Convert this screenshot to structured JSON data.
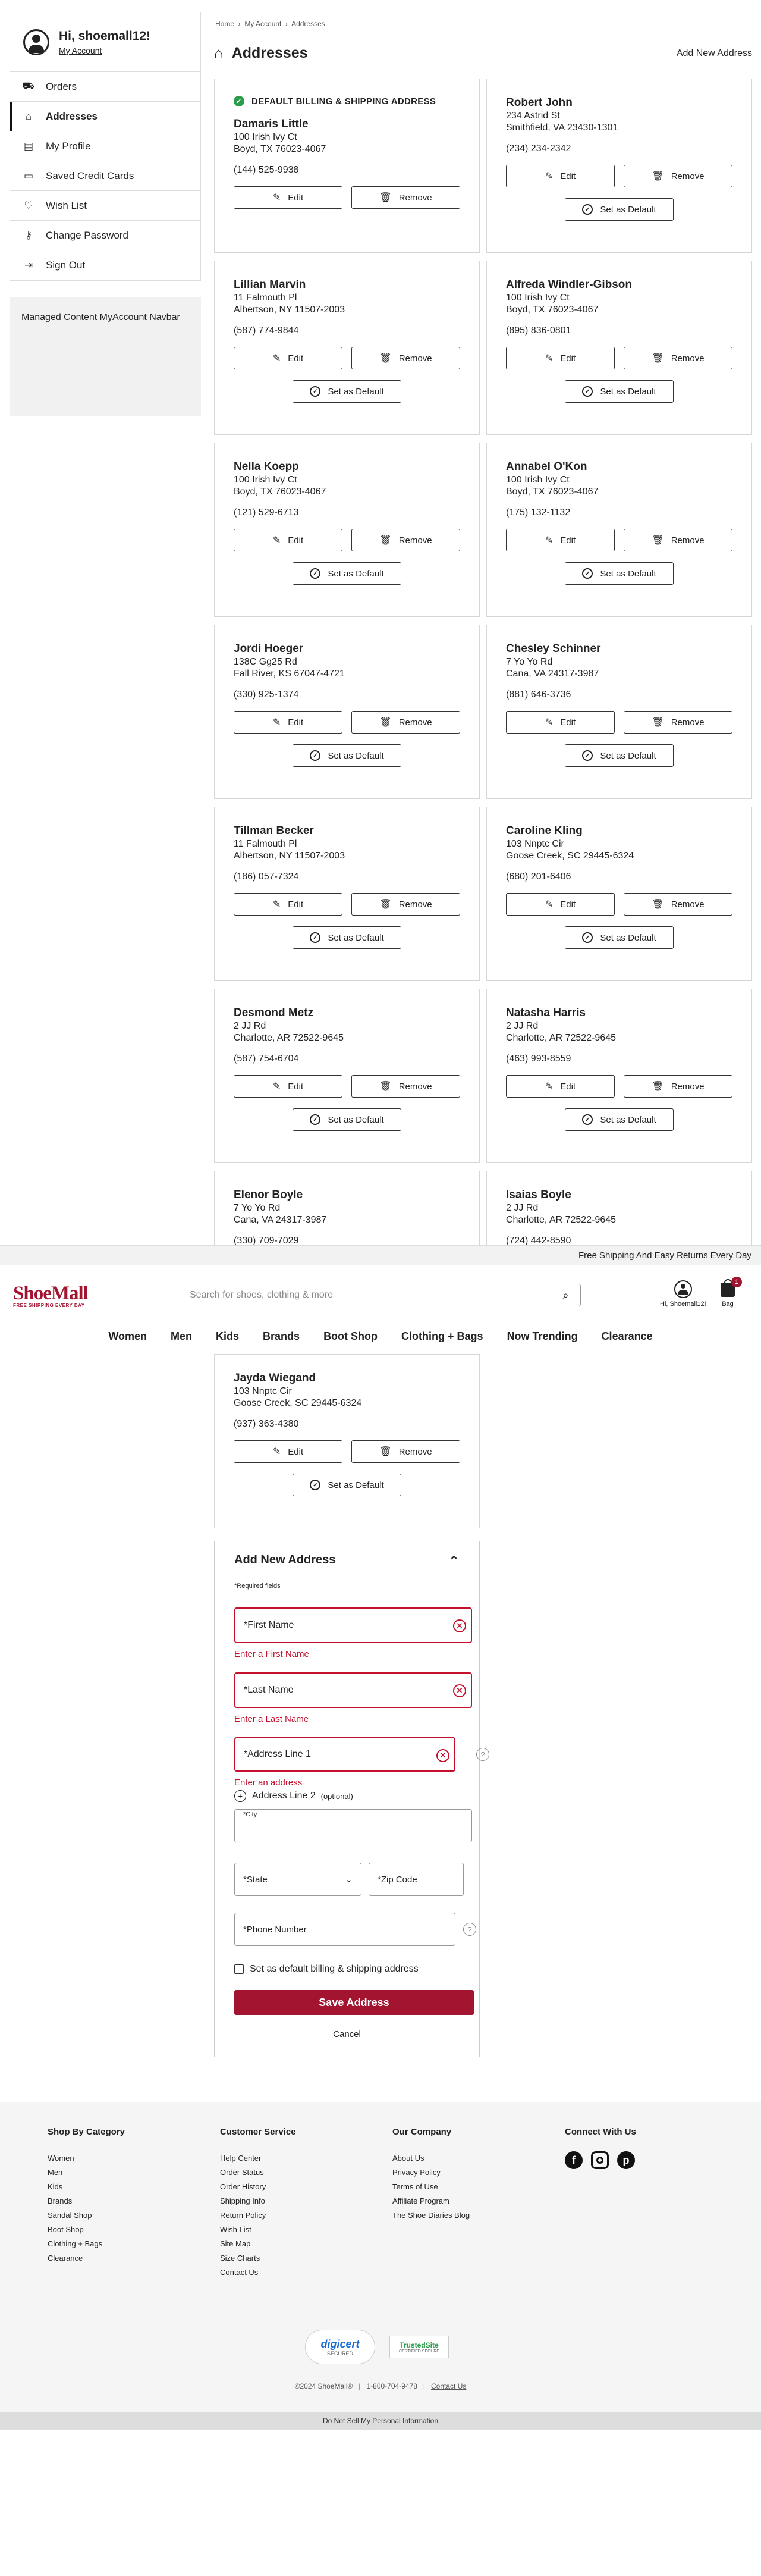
{
  "account": {
    "greeting": "Hi, shoemall12!",
    "link": "My Account"
  },
  "sidebar": {
    "items": [
      {
        "label": "Orders",
        "icon": "truck-icon"
      },
      {
        "label": "Addresses",
        "icon": "home-icon",
        "active": true
      },
      {
        "label": "My Profile",
        "icon": "profile-card-icon"
      },
      {
        "label": "Saved Credit Cards",
        "icon": "credit-card-icon"
      },
      {
        "label": "Wish List",
        "icon": "heart-icon"
      },
      {
        "label": "Change Password",
        "icon": "key-icon"
      },
      {
        "label": "Sign Out",
        "icon": "sign-out-icon"
      }
    ]
  },
  "managed": "Managed Content MyAccount Navbar",
  "breadcrumb": {
    "home": "Home",
    "account": "My Account",
    "current": "Addresses"
  },
  "page": {
    "title": "Addresses",
    "add_new": "Add New Address"
  },
  "labels": {
    "default_badge": "DEFAULT BILLING & SHIPPING ADDRESS",
    "edit": "Edit",
    "remove": "Remove",
    "set_default": "Set as Default"
  },
  "addresses": [
    {
      "name": "Damaris Little",
      "line1": "100 Irish Ivy Ct",
      "line2": "Boyd, TX 76023-4067",
      "phone": "(144) 525-9938",
      "default": true
    },
    {
      "name": "Robert John",
      "line1": "234 Astrid St",
      "line2": "Smithfield, VA 23430-1301",
      "phone": "(234) 234-2342"
    },
    {
      "name": "Lillian Marvin",
      "line1": "11 Falmouth Pl",
      "line2": "Albertson, NY 11507-2003",
      "phone": "(587) 774-9844"
    },
    {
      "name": "Alfreda Windler-Gibson",
      "line1": "100 Irish Ivy Ct",
      "line2": "Boyd, TX 76023-4067",
      "phone": "(895) 836-0801"
    },
    {
      "name": "Nella Koepp",
      "line1": "100 Irish Ivy Ct",
      "line2": "Boyd, TX 76023-4067",
      "phone": "(121) 529-6713"
    },
    {
      "name": "Annabel O'Kon",
      "line1": "100 Irish Ivy Ct",
      "line2": "Boyd, TX 76023-4067",
      "phone": "(175) 132-1132"
    },
    {
      "name": "Jordi Hoeger",
      "line1": "138C Gg25 Rd",
      "line2": "Fall River, KS 67047-4721",
      "phone": "(330) 925-1374"
    },
    {
      "name": "Chesley Schinner",
      "line1": "7 Yo Yo Rd",
      "line2": "Cana, VA 24317-3987",
      "phone": "(881) 646-3736"
    },
    {
      "name": "Tillman Becker",
      "line1": "11 Falmouth Pl",
      "line2": "Albertson, NY 11507-2003",
      "phone": "(186) 057-7324"
    },
    {
      "name": "Caroline Kling",
      "line1": "103 Nnptc Cir",
      "line2": "Goose Creek, SC 29445-6324",
      "phone": "(680) 201-6406"
    },
    {
      "name": "Desmond Metz",
      "line1": "2 JJ Rd",
      "line2": "Charlotte, AR 72522-9645",
      "phone": "(587) 754-6704"
    },
    {
      "name": "Natasha Harris",
      "line1": "2 JJ Rd",
      "line2": "Charlotte, AR 72522-9645",
      "phone": "(463) 993-8559"
    },
    {
      "name": "Elenor Boyle",
      "line1": "7 Yo Yo Rd",
      "line2": "Cana, VA 24317-3987",
      "phone": "(330) 709-7029"
    },
    {
      "name": "Isaias Boyle",
      "line1": "2 JJ Rd",
      "line2": "Charlotte, AR 72522-9645",
      "phone": "(724) 442-8590"
    },
    {
      "name": "Jayda Wiegand",
      "line1": "103 Nnptc Cir",
      "line2": "Goose Creek, SC 29445-6324",
      "phone": "(937) 363-4380"
    }
  ],
  "promo": "Free Shipping And Easy Returns Every Day",
  "header": {
    "logo": "ShoeMall",
    "logo_tagline": "FREE SHIPPING EVERY DAY",
    "search_placeholder": "Search for shoes, clothing & more",
    "user_label": "Hi, Shoemall12!",
    "bag_label": "Bag",
    "bag_count": "1"
  },
  "catnav": [
    "Women",
    "Men",
    "Kids",
    "Brands",
    "Boot Shop",
    "Clothing + Bags",
    "Now Trending",
    "Clearance"
  ],
  "form": {
    "title": "Add New Address",
    "required_note": "*Required fields",
    "first_name": "*First Name",
    "first_name_err": "Enter a First Name",
    "last_name": "*Last Name",
    "last_name_err": "Enter a Last Name",
    "address1": "*Address Line 1",
    "address1_err": "Enter an address",
    "address2": "Address Line 2",
    "optional": "(optional)",
    "city": "*City",
    "state": "*State",
    "zip": "*Zip Code",
    "phone": "*Phone Number",
    "default_check": "Set as default billing & shipping address",
    "save": "Save Address",
    "cancel": "Cancel"
  },
  "footer": {
    "cat": {
      "title": "Shop By Category",
      "links": [
        "Women",
        "Men",
        "Kids",
        "Brands",
        "Sandal Shop",
        "Boot Shop",
        "Clothing + Bags",
        "Clearance"
      ]
    },
    "cs": {
      "title": "Customer Service",
      "links": [
        "Help Center",
        "Order Status",
        "Order History",
        "Shipping Info",
        "Return Policy",
        "Wish List",
        "Site Map",
        "Size Charts",
        "Contact Us"
      ]
    },
    "co": {
      "title": "Our Company",
      "links": [
        "About Us",
        "Privacy Policy",
        "Terms of Use",
        "Affiliate Program",
        "The Shoe Diaries Blog"
      ]
    },
    "connect": "Connect With Us",
    "digicert": "digicert",
    "digicert_sub": "SECURED",
    "trusted": "TrustedSite",
    "trusted_sub": "CERTIFIED SECURE",
    "copyright": "©2024 ShoeMall®",
    "phone": "1-800-704-9478",
    "contact": "Contact Us",
    "dnsm": "Do Not Sell My Personal Information"
  }
}
